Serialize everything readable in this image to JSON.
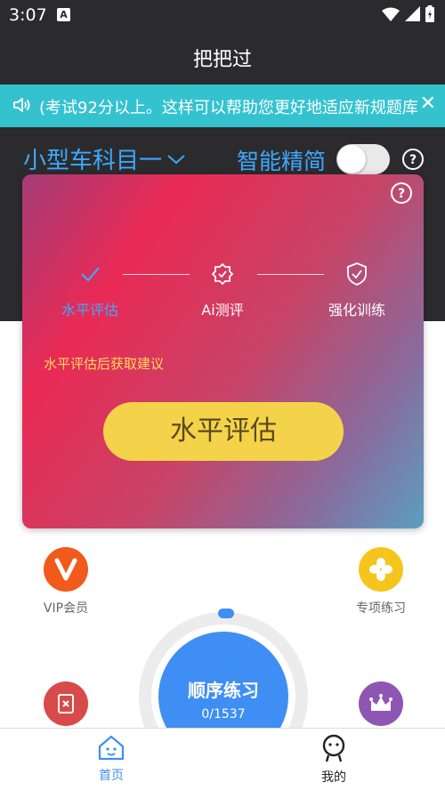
{
  "status": {
    "time": "3:07",
    "notification_letter": "A"
  },
  "header": {
    "title": "把把过"
  },
  "notice": {
    "text": "(考试92分以上。这样可以帮助您更好地适应新规题库"
  },
  "top_controls": {
    "subject": "小型车科目一",
    "smart_label": "智能精简",
    "smart_enabled": false
  },
  "card": {
    "steps": [
      {
        "label": "水平评估",
        "state": "done"
      },
      {
        "label": "Ai测评",
        "state": "pending"
      },
      {
        "label": "强化训练",
        "state": "pending"
      }
    ],
    "advice": "水平评估后获取建议",
    "button_label": "水平评估"
  },
  "features": {
    "vip": {
      "label": "VIP会员",
      "color": "#f15a1b"
    },
    "special": {
      "label": "专项练习",
      "color": "#f6c51d"
    },
    "wrong": {
      "color": "#d94a4a"
    },
    "crown": {
      "color": "#8e55b5"
    }
  },
  "practice": {
    "title": "顺序练习",
    "count": "0/1537"
  },
  "nav": {
    "home": "首页",
    "mine": "我的",
    "active_color": "#3f8ef3"
  }
}
